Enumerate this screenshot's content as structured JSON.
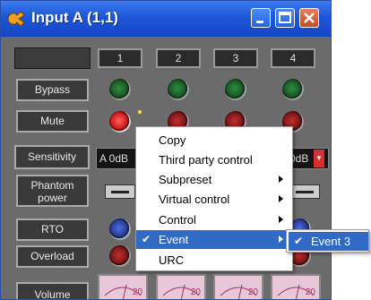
{
  "window": {
    "title": "Input A (1,1)",
    "titlebar_color": "#1c56d6"
  },
  "columns": [
    "1",
    "2",
    "3",
    "4"
  ],
  "rows": {
    "bypass": "Bypass",
    "mute": "Mute",
    "sensitivity": "Sensitivity",
    "phantom_line1": "Phantom",
    "phantom_line2": "power",
    "rto": "RTO",
    "overload": "Overload",
    "volume": "Volume"
  },
  "sensitivity_values": [
    "A 0dB",
    "0dB"
  ],
  "meter_labels": [
    "20",
    "20",
    "20",
    "20"
  ],
  "context_menu": {
    "items": [
      {
        "label": "Copy"
      },
      {
        "label": "Third party control"
      },
      {
        "label": "Subpreset"
      },
      {
        "label": "Virtual control"
      },
      {
        "label": "Control"
      },
      {
        "label": "Event"
      },
      {
        "label": "URC"
      }
    ],
    "checkmark": "✔"
  },
  "submenu": {
    "items": [
      {
        "label": "Event 3"
      }
    ]
  }
}
